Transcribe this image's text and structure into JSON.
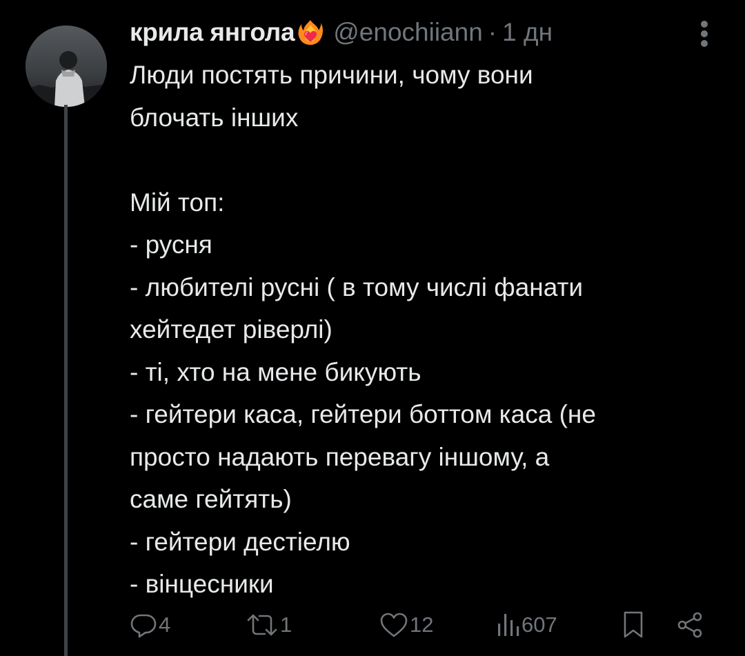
{
  "tweet": {
    "display_name": "крила янгола",
    "handle": "@enochiiann",
    "separator": "·",
    "time": "1 дн",
    "lines": [
      "Люди постять причини, чому вони",
      "блочать інших",
      "",
      "Мій топ:",
      "- русня",
      "- любителі русні ( в тому числі фанати",
      "хейтедет ріверлі)",
      "- ті, хто на мене бикують",
      "- гейтери каса, гейтери боттом каса (не",
      "просто надають перевагу іншому, а",
      "саме гейтять)",
      "- гейтери дестіелю",
      "- вінцесники"
    ]
  },
  "icons": {
    "name_emoji": "heart-on-fire-icon",
    "more": "more-vertical-icon",
    "reply": "reply-icon",
    "retweet": "retweet-icon",
    "like": "like-icon",
    "views": "views-icon",
    "bookmark": "bookmark-icon",
    "share": "share-icon"
  },
  "actions": {
    "replies": "4",
    "retweets": "1",
    "likes": "12",
    "views": "607"
  },
  "colors": {
    "background": "#000000",
    "text_primary": "#e7e9ea",
    "text_secondary": "#71767b",
    "thread_line": "#3f4347"
  }
}
